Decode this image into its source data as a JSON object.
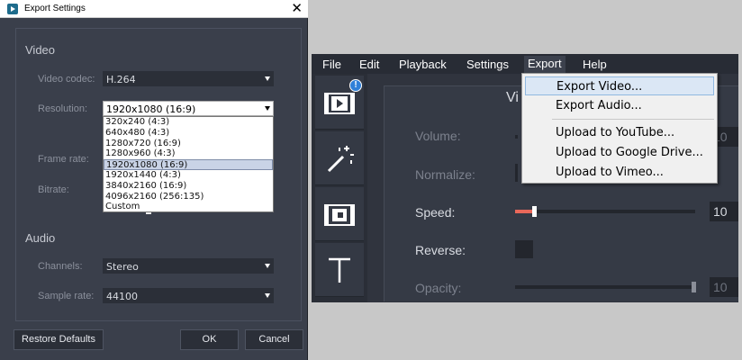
{
  "dialog": {
    "title": "Export Settings",
    "video_section": "Video",
    "video_codec_label": "Video codec:",
    "video_codec_value": "H.264",
    "resolution_label": "Resolution:",
    "resolution_value": "1920x1080 (16:9)",
    "resolution_options": [
      "320x240 (4:3)",
      "640x480 (4:3)",
      "1280x720 (16:9)",
      "1280x960 (4:3)",
      "1920x1080 (16:9)",
      "1920x1440 (4:3)",
      "3840x2160 (16:9)",
      "4096x2160 (256:135)",
      "Custom"
    ],
    "frame_rate_label": "Frame rate:",
    "bitrate_label": "Bitrate:",
    "audio_section": "Audio",
    "channels_label": "Channels:",
    "channels_value": "Stereo",
    "sample_rate_label": "Sample rate:",
    "sample_rate_value": "44100",
    "restore_defaults": "Restore Defaults",
    "ok": "OK",
    "cancel": "Cancel",
    "close_glyph": "✕"
  },
  "editor": {
    "menu": [
      "File",
      "Edit",
      "Playback",
      "Settings",
      "Export",
      "Help"
    ],
    "properties_title_partial": "Vi",
    "badge": "!",
    "properties": {
      "volume_label": "Volume:",
      "volume_value": "10",
      "normalize_label": "Normalize:",
      "speed_label": "Speed:",
      "speed_value": "10",
      "reverse_label": "Reverse:",
      "opacity_label": "Opacity:",
      "opacity_value": "10"
    },
    "export_menu": [
      "Export Video...",
      "Export Audio...",
      "Upload to YouTube...",
      "Upload to Google Drive...",
      "Upload to Vimeo..."
    ]
  },
  "colors": {
    "accent": "#e9685a",
    "badge": "#2f80d8"
  }
}
